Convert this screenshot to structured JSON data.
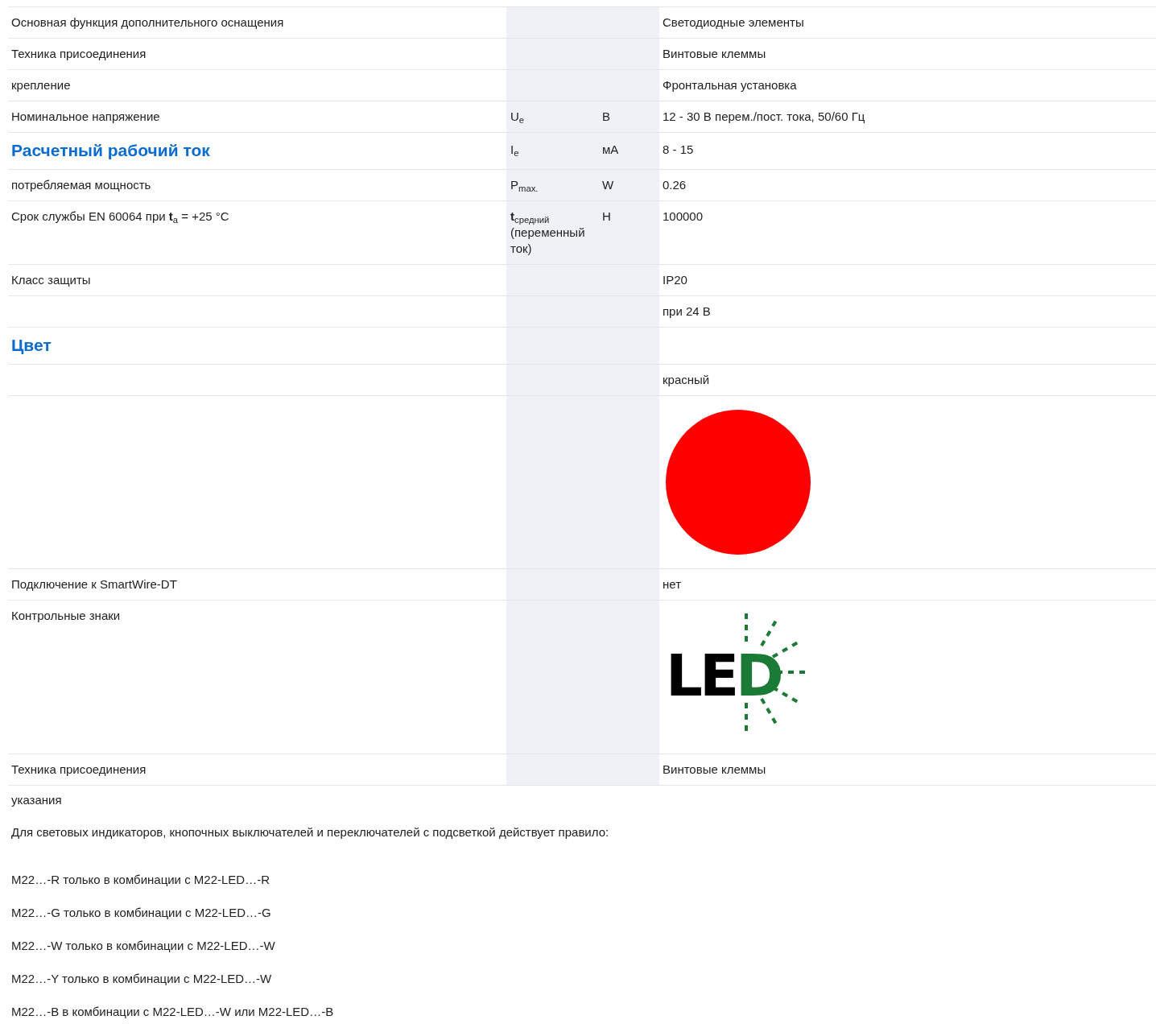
{
  "rows": [
    {
      "kind": "text",
      "label": "Основная функция дополнительного оснащения",
      "value": "Светодиодные элементы"
    },
    {
      "kind": "text",
      "label": "Техника присоединения",
      "value": "Винтовые клеммы"
    },
    {
      "kind": "text",
      "label": "крепление",
      "value": "Фронтальная установка"
    },
    {
      "kind": "text",
      "label": "Номинальное напряжение",
      "symbol": "U$_{e}$",
      "unit": "В",
      "value": "12 - 30 В перем./пост. тока, 50/60 Гц"
    },
    {
      "kind": "heading",
      "label": "Расчетный рабочий ток",
      "symbol": "I$_{e}$",
      "unit": "мА",
      "value": "8 - 15"
    },
    {
      "kind": "text",
      "label": "потребляемая мощность",
      "symbol": "P$_{max.}$",
      "unit": "W",
      "value": "0.26"
    },
    {
      "kind": "text",
      "label": "Срок службы EN 60064 при **t**$_{a}$ = +25 °C",
      "symbol": "**t**$_{средний}$ (переменный ток)",
      "unit": "H",
      "value": "100000"
    },
    {
      "kind": "text",
      "label": "Класс защиты",
      "value": "IP20"
    },
    {
      "kind": "text",
      "value": "при 24 В"
    },
    {
      "kind": "heading",
      "label": "Цвет"
    },
    {
      "kind": "text",
      "value": "красный"
    },
    {
      "kind": "swatch",
      "color": "#ff0000"
    },
    {
      "kind": "text",
      "label": "Подключение к SmartWire-DT",
      "value": "нет"
    },
    {
      "kind": "logo",
      "label": "Контрольные знаки",
      "letters": [
        {
          "char": "L",
          "color": "#000000"
        },
        {
          "char": "E",
          "color": "#000000"
        },
        {
          "char": "D",
          "color": "#1b7a36"
        }
      ]
    },
    {
      "kind": "text",
      "label": "Техника присоединения",
      "value": "Винтовые клеммы"
    }
  ],
  "notes": {
    "title": "указания",
    "paragraphs": [
      "Для световых индикаторов, кнопочных выключателей и переключателей с подсветкой действует правило:",
      "M22…-R только в комбинации с M22-LED…-R",
      "M22…-G только в комбинации с M22-LED…-G",
      "M22…-W только в комбинации с M22-LED…-W",
      "M22…-Y только в комбинации с M22-LED…-W",
      "M22…-B в комбинации с M22-LED…-W или M22-LED…-B"
    ]
  }
}
